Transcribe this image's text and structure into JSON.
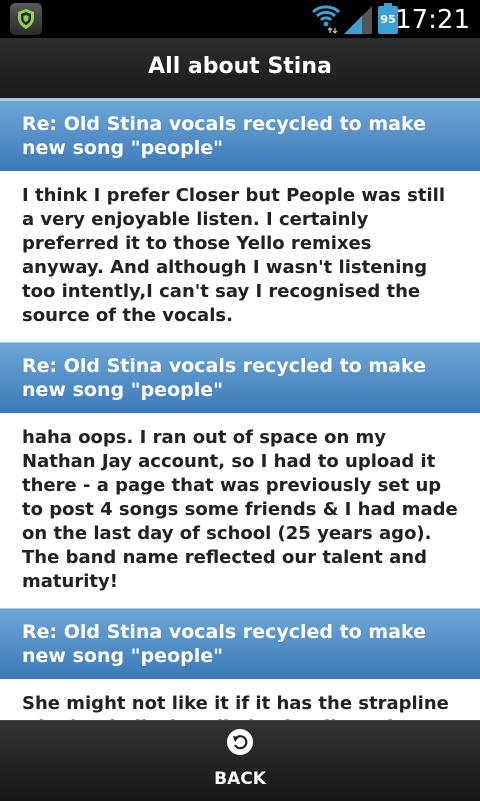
{
  "status_bar": {
    "battery": "95",
    "time": "17:21",
    "icons": [
      "shield-app-icon",
      "wifi-icon",
      "signal-icon",
      "battery-icon"
    ]
  },
  "header": {
    "title": "All about Stina"
  },
  "posts": [
    {
      "title": "Re: Old Stina vocals recycled to make new song \"people\"",
      "body": "I think I prefer Closer but People was still a very enjoyable listen. I certainly preferred it to those Yello remixes anyway. And although I wasn't listening too intently,I can't say I recognised the source of the vocals."
    },
    {
      "title": "Re: Old Stina vocals recycled to make new song \"people\"",
      "body": "haha oops. I ran out of space on my Nathan Jay account, so I had to upload it there - a page that was previously set up to post 4 songs some friends & I had made on the last day of school (25 years ago). The band name reflected our talent and maturity!"
    },
    {
      "title": "Re: Old Stina vocals recycled to make new song \"people\"",
      "body": "She might not like it if it has the strapline 'singing-bollocks' I'll give it a listen later."
    }
  ],
  "footer": {
    "back_label": "BACK",
    "back_icon": "back-arrow-icon"
  },
  "colors": {
    "header_blue": "#4a86c2",
    "accent_light_blue": "#9fc5e6"
  }
}
